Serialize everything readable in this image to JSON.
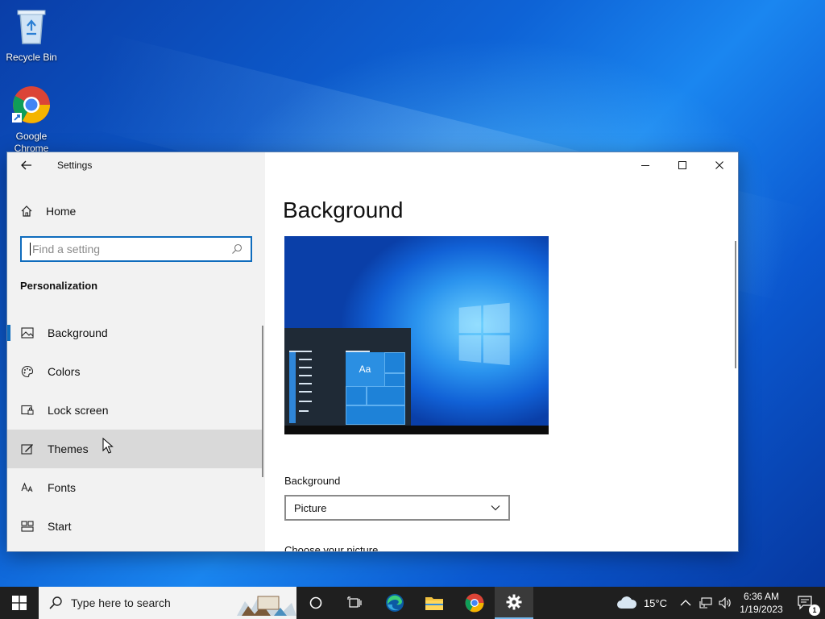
{
  "desktop": {
    "icons": [
      {
        "label": "Recycle Bin",
        "icon": "recycle-bin-icon"
      },
      {
        "label": "Google Chrome",
        "icon": "chrome-icon"
      }
    ]
  },
  "window": {
    "app_title": "Settings",
    "controls": {
      "minimize": "minimize-icon",
      "maximize": "maximize-icon",
      "close": "close-icon"
    }
  },
  "sidebar": {
    "home_label": "Home",
    "search_placeholder": "Find a setting",
    "section_title": "Personalization",
    "items": [
      {
        "label": "Background",
        "icon": "image-icon",
        "selected": true
      },
      {
        "label": "Colors",
        "icon": "palette-icon"
      },
      {
        "label": "Lock screen",
        "icon": "lock-screen-icon"
      },
      {
        "label": "Themes",
        "icon": "themes-icon",
        "hovered": true
      },
      {
        "label": "Fonts",
        "icon": "fonts-icon"
      },
      {
        "label": "Start",
        "icon": "start-icon"
      }
    ]
  },
  "content": {
    "page_title": "Background",
    "preview_tile_text": "Aa",
    "background_label": "Background",
    "background_value": "Picture",
    "choose_label": "Choose your picture"
  },
  "taskbar": {
    "search_placeholder": "Type here to search",
    "weather": "15°C",
    "time": "6:36 AM",
    "date": "1/19/2023",
    "notification_count": "1"
  },
  "colors": {
    "accent": "#0f6cbd",
    "sidebar_bg": "#f2f2f2",
    "taskbar_bg": "#1f1f1f"
  }
}
